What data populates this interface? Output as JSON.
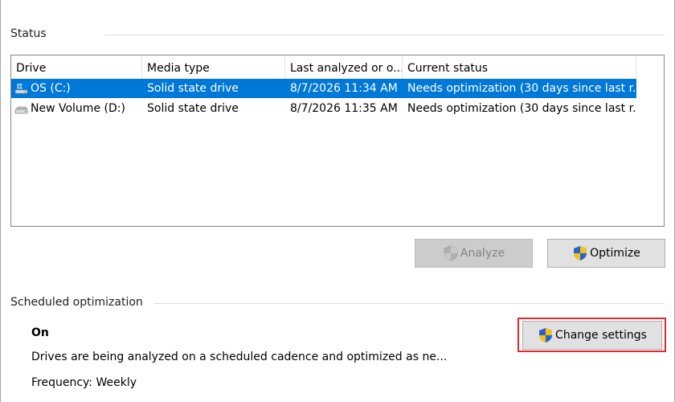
{
  "status_section": {
    "label": "Status"
  },
  "drive_list": {
    "columns": [
      "Drive",
      "Media type",
      "Last analyzed or o...",
      "Current status"
    ],
    "rows": [
      {
        "drive": "OS (C:)",
        "media_type": "Solid state drive",
        "last_analyzed": "8/7/2026 11:34 AM",
        "current_status": "Needs optimization (30 days since last r...",
        "selected": true,
        "icon": "windows-drive-icon"
      },
      {
        "drive": "New Volume (D:)",
        "media_type": "Solid state drive",
        "last_analyzed": "8/7/2026 11:35 AM",
        "current_status": "Needs optimization (30 days since last r...",
        "selected": false,
        "icon": "drive-icon"
      }
    ]
  },
  "buttons": {
    "analyze": "Analyze",
    "optimize": "Optimize",
    "change_settings": "Change settings"
  },
  "scheduled_section": {
    "label": "Scheduled optimization",
    "status": "On",
    "description": "Drives are being analyzed on a scheduled cadence and optimized as ne...",
    "frequency": "Frequency: Weekly"
  },
  "colors": {
    "selection": "#0078d7",
    "highlight_box": "#e0282c",
    "button_face": "#e1e1e1",
    "button_disabled": "#cccccc",
    "shield_blue": "#2a62c9",
    "shield_yellow": "#f2c21a"
  }
}
